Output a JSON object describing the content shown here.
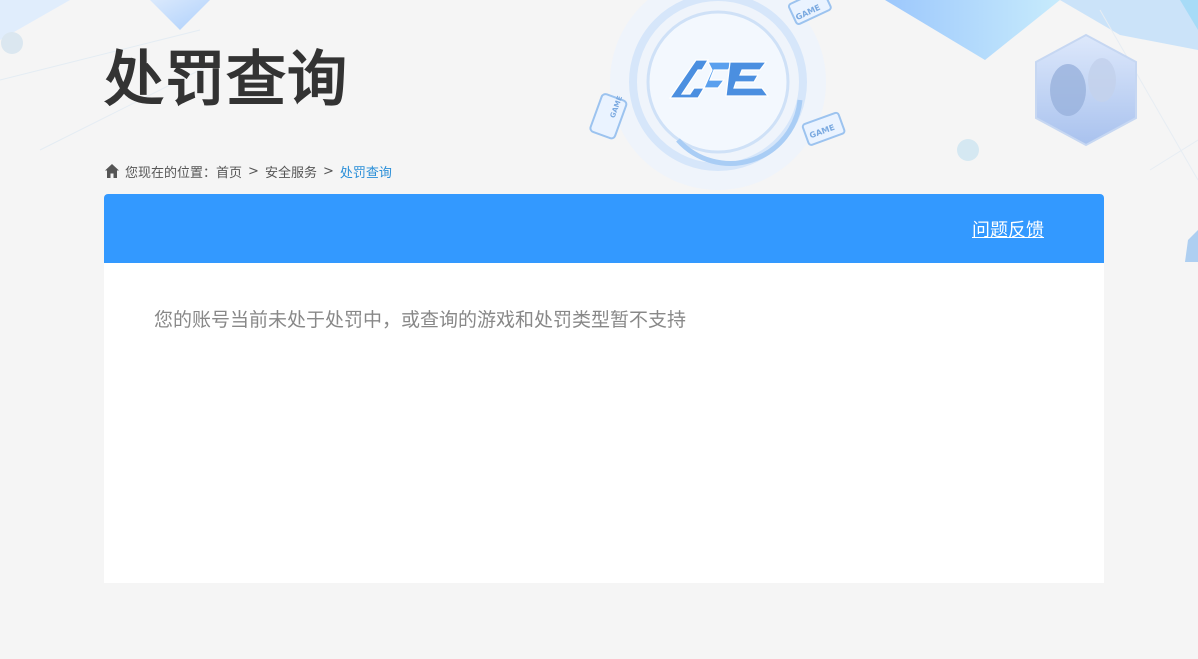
{
  "header": {
    "title": "处罚查询",
    "logo_text": "ACE",
    "badge_text": "GAME"
  },
  "breadcrumb": {
    "prefix": "您现在的位置：",
    "items": [
      "首页",
      "安全服务"
    ],
    "separator": ">",
    "current": "处罚查询"
  },
  "panel": {
    "feedback_label": "问题反馈",
    "message": "您的账号当前未处于处罚中，或查询的游戏和处罚类型暂不支持"
  },
  "colors": {
    "accent": "#3399ff",
    "breadcrumb_current": "#2a8fd8",
    "background": "#f5f5f5"
  }
}
